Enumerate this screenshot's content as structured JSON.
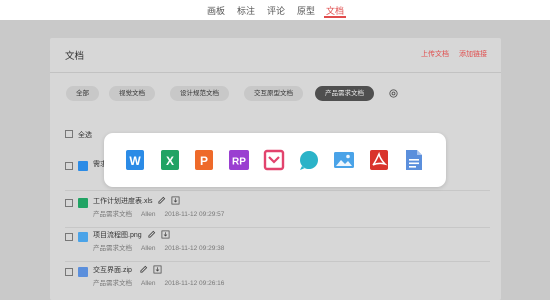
{
  "topnav": {
    "items": [
      {
        "label": "画板",
        "active": false
      },
      {
        "label": "标注",
        "active": false
      },
      {
        "label": "评论",
        "active": false
      },
      {
        "label": "原型",
        "active": false
      },
      {
        "label": "文档",
        "active": true
      }
    ],
    "active_color": "#e04c4c"
  },
  "panel": {
    "title": "文档",
    "actions": {
      "upload": "上传文档",
      "add_link": "添加链接"
    },
    "filters": [
      "全部",
      "视觉文档",
      "设计规范文档",
      "交互原型文档",
      "产品需求文档"
    ],
    "active_filter": "产品需求文档",
    "select_all": "全选"
  },
  "files": [
    {
      "name": "需求",
      "type": "word",
      "category": "",
      "author": "",
      "date": ""
    },
    {
      "name": "工作计划进度表.xls",
      "type": "excel",
      "category": "产品需求文档",
      "author": "Allen",
      "date": "2018-11-12 09:29:57"
    },
    {
      "name": "项目流程图.png",
      "type": "image",
      "category": "产品需求文档",
      "author": "Allen",
      "date": "2018-11-12 09:29:38"
    },
    {
      "name": "交互界面.zip",
      "type": "file",
      "category": "产品需求文档",
      "author": "Allen",
      "date": "2018-11-12 09:26:16"
    }
  ],
  "file_type_icons": [
    {
      "name": "word-icon",
      "letter": "W",
      "color": "#2b8be6"
    },
    {
      "name": "excel-icon",
      "letter": "X",
      "color": "#21a364"
    },
    {
      "name": "powerpoint-icon",
      "letter": "P",
      "color": "#ee6a2a"
    },
    {
      "name": "rp-icon",
      "letter": "RP",
      "color": "#9a3fd1"
    },
    {
      "name": "mindmap-icon",
      "letter": "",
      "color": "#e2436d"
    },
    {
      "name": "keynote-icon",
      "letter": "",
      "color": "#2bb3c8"
    },
    {
      "name": "image-icon",
      "letter": "",
      "color": "#4aa3e8"
    },
    {
      "name": "pdf-icon",
      "letter": "",
      "color": "#d9332b"
    },
    {
      "name": "document-icon",
      "letter": "",
      "color": "#5b8fdc"
    }
  ]
}
